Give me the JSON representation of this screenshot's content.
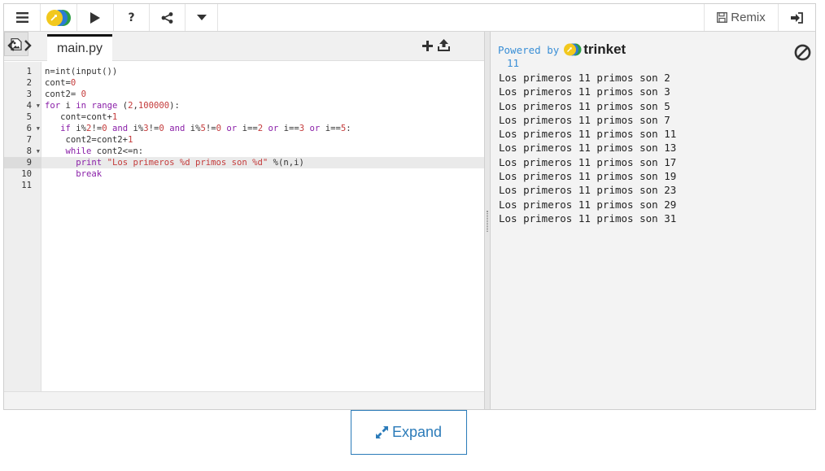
{
  "toolbar": {
    "menu_icon": "hamburger-menu-icon",
    "logo_icon": "trinket-logo-icon",
    "run_icon": "play-icon",
    "help_label": "?",
    "share_icon": "share-icon",
    "more_icon": "caret-down-icon",
    "remix_label": "Remix",
    "login_icon": "sign-in-icon"
  },
  "editor": {
    "nav_label": "<>",
    "file_tab": "main.py",
    "add_icon": "plus-icon",
    "upload_icon": "upload-icon",
    "image_icon": "image-icon",
    "active_line": 9,
    "lines": [
      {
        "n": "1",
        "fold": false
      },
      {
        "n": "2",
        "fold": false
      },
      {
        "n": "3",
        "fold": false
      },
      {
        "n": "4",
        "fold": true
      },
      {
        "n": "5",
        "fold": false
      },
      {
        "n": "6",
        "fold": true
      },
      {
        "n": "7",
        "fold": false
      },
      {
        "n": "8",
        "fold": true
      },
      {
        "n": "9",
        "fold": false
      },
      {
        "n": "10",
        "fold": false
      },
      {
        "n": "11",
        "fold": false
      }
    ],
    "code": [
      "n=int(input())",
      "cont=0",
      "cont2= 0",
      "for i in range (2,100000):",
      "   cont=cont+1",
      "   if i%2!=0 and i%3!=0 and i%5!=0 or i==2 or i==3 or i==5:",
      "    cont2=cont2+1",
      "    while cont2<=n:",
      "      print \"Los primeros %d primos son %d\" %(n,i)",
      "      break",
      ""
    ]
  },
  "output": {
    "powered_by": "Powered by",
    "brand": "trinket",
    "clear_icon": "ban-icon",
    "input_echo": "11",
    "lines": [
      "Los primeros 11 primos son 2",
      "Los primeros 11 primos son 3",
      "Los primeros 11 primos son 5",
      "Los primeros 11 primos son 7",
      "Los primeros 11 primos son 11",
      "Los primeros 11 primos son 13",
      "Los primeros 11 primos son 17",
      "Los primeros 11 primos son 19",
      "Los primeros 11 primos son 23",
      "Los primeros 11 primos son 29",
      "Los primeros 11 primos son 31"
    ]
  },
  "expand": {
    "label": "Expand",
    "icon": "expand-arrows-icon"
  },
  "colors": {
    "accent": "#2b7bb9",
    "keyword": "#8a1fa8",
    "number": "#c43b3b",
    "output_blue": "#3a8fd6"
  }
}
